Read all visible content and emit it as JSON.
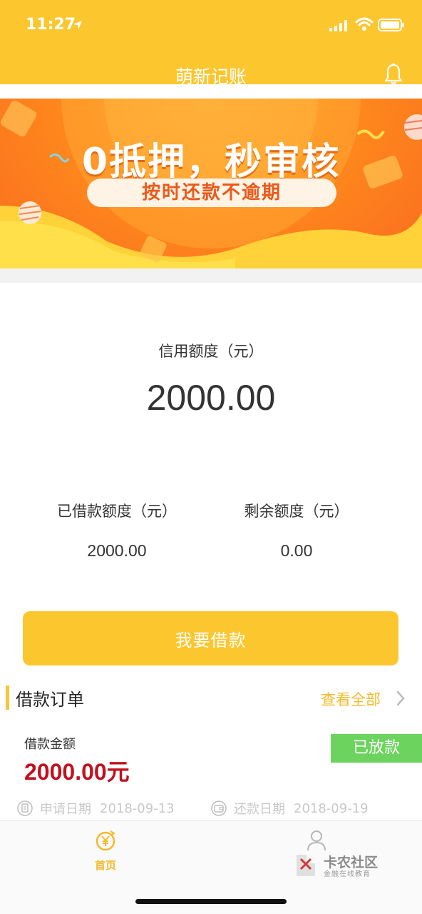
{
  "status_bar": {
    "time": "11:27"
  },
  "header": {
    "title": "萌新记账"
  },
  "banner": {
    "headline": "0抵押，秒审核",
    "subline": "按时还款不逾期"
  },
  "credit": {
    "label": "信用额度（元）",
    "amount": "2000.00",
    "borrowed_label": "已借款额度（元）",
    "borrowed_value": "2000.00",
    "remaining_label": "剩余额度（元）",
    "remaining_value": "0.00"
  },
  "actions": {
    "borrow_label": "我要借款"
  },
  "orders": {
    "title": "借款订单",
    "view_all": "查看全部",
    "item": {
      "amount_label": "借款金额",
      "amount": "2000.00元",
      "status": "已放款",
      "apply_label": "申请日期",
      "apply_date": "2018-09-13",
      "repay_label": "还款日期",
      "repay_date": "2018-09-19"
    }
  },
  "tabbar": {
    "home_label": "首页",
    "home_icon": "yen-home-icon",
    "mine_icon": "user-icon"
  },
  "watermark": {
    "title": "卡农社区",
    "subtitle": "金融在线教育"
  },
  "colors": {
    "brand": "#fcc62f",
    "amount_red": "#c1121f",
    "badge_green": "#6dd35f",
    "link_orange": "#f5b92a"
  }
}
